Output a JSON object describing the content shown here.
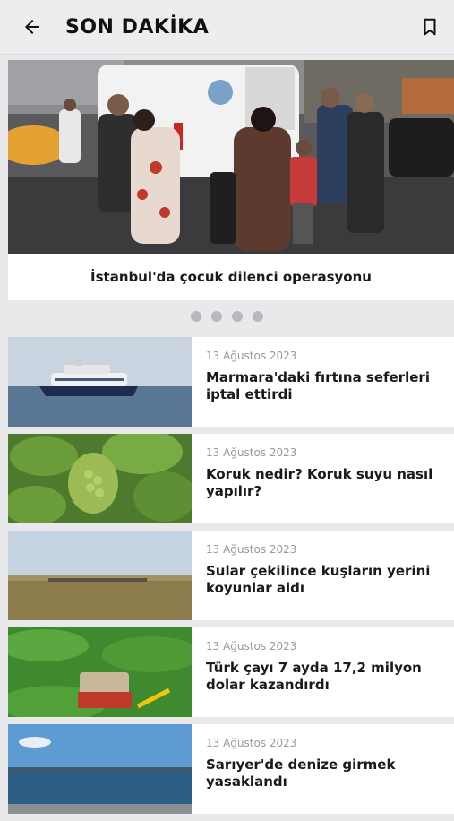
{
  "appbar": {
    "title": "SON DAKİKA",
    "back_icon": "arrow-left-icon",
    "bookmark_icon": "bookmark-icon"
  },
  "hero": {
    "caption": "İstanbul'da çocuk dilenci operasyonu",
    "dots_count": 4
  },
  "news": [
    {
      "date": "13 Ağustos 2023",
      "title": "Marmara'daki fırtına seferleri iptal ettirdi"
    },
    {
      "date": "13 Ağustos 2023",
      "title": "Koruk nedir? Koruk suyu nasıl yapılır?"
    },
    {
      "date": "13 Ağustos 2023",
      "title": "Sular çekilince kuşların yerini koyunlar aldı"
    },
    {
      "date": "13 Ağustos 2023",
      "title": "Türk çayı 7 ayda 17,2 milyon dolar kazandırdı"
    },
    {
      "date": "13 Ağustos 2023",
      "title": "Sarıyer'de denize girmek yasaklandı"
    }
  ],
  "colors": {
    "appbar": "#ededee",
    "card": "#ffffff",
    "dot": "#b9b9bd",
    "date": "#9a9a9e"
  }
}
